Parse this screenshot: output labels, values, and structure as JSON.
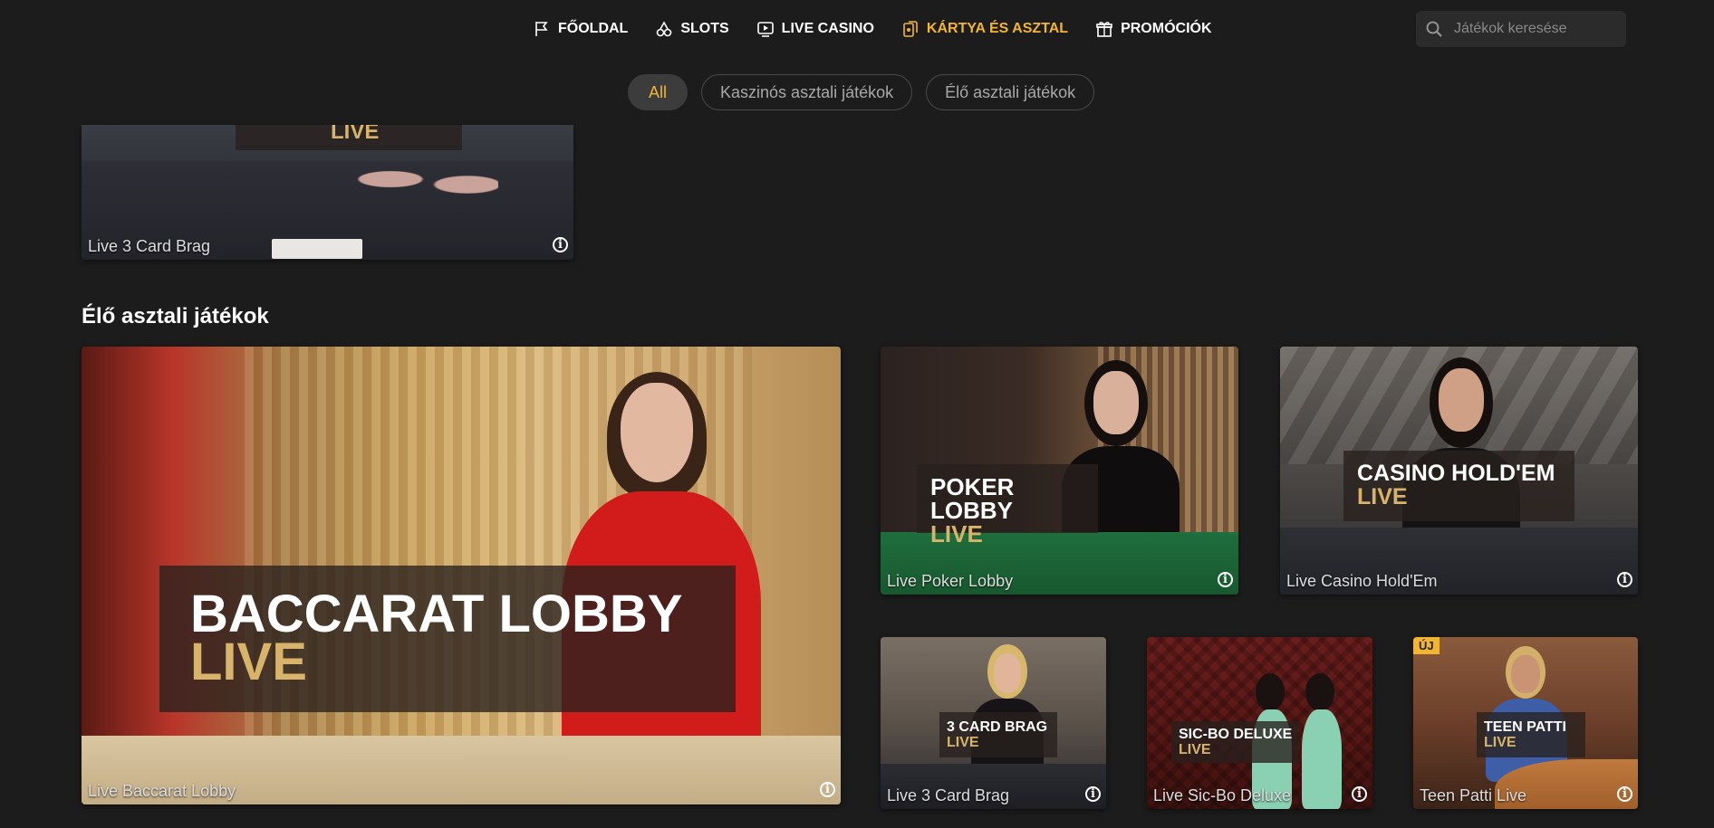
{
  "nav": {
    "items": [
      {
        "label": "FŐOLDAL",
        "icon": "flag-icon"
      },
      {
        "label": "SLOTS",
        "icon": "cherries-icon"
      },
      {
        "label": "LIVE CASINO",
        "icon": "play-screen-icon"
      },
      {
        "label": "KÁRTYA ÉS ASZTAL",
        "icon": "cards-icon",
        "active": true
      },
      {
        "label": "PROMÓCIÓK",
        "icon": "gift-icon"
      }
    ],
    "search_placeholder": "Játékok keresése"
  },
  "filters": [
    {
      "label": "All",
      "active": true
    },
    {
      "label": "Kaszinós asztali játékok"
    },
    {
      "label": "Élő asztali játékok"
    }
  ],
  "section": {
    "title": "Élő asztali játékok"
  },
  "tiles": {
    "top_partial": {
      "caption": "Live 3 Card Brag",
      "banner_line2": "LIVE"
    },
    "baccarat": {
      "caption": "Live Baccarat Lobby",
      "banner_line1": "BACCARAT LOBBY",
      "banner_line2": "LIVE"
    },
    "poker": {
      "caption": "Live Poker Lobby",
      "banner_line1": "POKER LOBBY",
      "banner_line2": "LIVE"
    },
    "holdem": {
      "caption": "Live Casino Hold'Em",
      "banner_line1": "CASINO HOLD'EM",
      "banner_line2": "LIVE"
    },
    "brag": {
      "caption": "Live 3 Card Brag",
      "banner_line1": "3 CARD BRAG",
      "banner_line2": "LIVE"
    },
    "sicbo": {
      "caption": "Live Sic-Bo Deluxe",
      "banner_line1": "SIC-BO DELUXE",
      "banner_line2": "LIVE"
    },
    "teenpatti": {
      "caption": "Teen Patti Live",
      "banner_line1": "TEEN PATTI",
      "banner_line2": "LIVE",
      "badge": "ÚJ"
    }
  },
  "info_glyph": "i",
  "colors": {
    "accent": "#f2b531",
    "background": "#1c1c1c",
    "live_gold": "#d8b46a"
  }
}
